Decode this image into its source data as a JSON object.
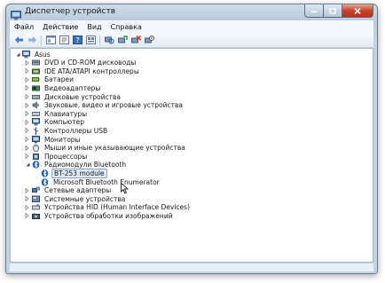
{
  "window": {
    "title": "Диспетчер устройств"
  },
  "menu": [
    {
      "label": "Файл"
    },
    {
      "label": "Действие"
    },
    {
      "label": "Вид"
    },
    {
      "label": "Справка"
    }
  ],
  "tree": {
    "root": {
      "label": "Asus",
      "icon": "computer-icon"
    },
    "items": [
      {
        "label": "DVD и CD-ROM дисководы",
        "icon": "dvd-drive-icon"
      },
      {
        "label": "IDE ATA/ATAPI контроллеры",
        "icon": "ide-controller-icon"
      },
      {
        "label": "Батареи",
        "icon": "battery-icon"
      },
      {
        "label": "Видеоадаптеры",
        "icon": "display-adapter-icon"
      },
      {
        "label": "Дисковые устройства",
        "icon": "disk-drive-icon"
      },
      {
        "label": "Звуковые, видео и игровые устройства",
        "icon": "sound-icon"
      },
      {
        "label": "Клавиатуры",
        "icon": "keyboard-icon"
      },
      {
        "label": "Компьютер",
        "icon": "computer-icon"
      },
      {
        "label": "Контроллеры USB",
        "icon": "usb-icon"
      },
      {
        "label": "Мониторы",
        "icon": "monitor-icon"
      },
      {
        "label": "Мыши и иные указывающие устройства",
        "icon": "mouse-icon"
      },
      {
        "label": "Процессоры",
        "icon": "processor-icon"
      },
      {
        "label": "Радиомодули Bluetooth",
        "icon": "bluetooth-icon",
        "expanded": true,
        "children": [
          {
            "label": "BT-253 module",
            "icon": "bluetooth-icon",
            "selected": true
          },
          {
            "label": "Microsoft Bluetooth Enumerator",
            "icon": "bluetooth-icon"
          }
        ]
      },
      {
        "label": "Сетевые адаптеры",
        "icon": "network-adapter-icon"
      },
      {
        "label": "Системные устройства",
        "icon": "system-devices-icon"
      },
      {
        "label": "Устройства HID (Human Interface Devices)",
        "icon": "hid-icon"
      },
      {
        "label": "Устройства обработки изображений",
        "icon": "imaging-device-icon"
      }
    ]
  },
  "colors": {
    "selection_bg": "#dde9f7",
    "selection_border": "#86a6cf",
    "bluetooth_blue": "#1f5fb8"
  }
}
